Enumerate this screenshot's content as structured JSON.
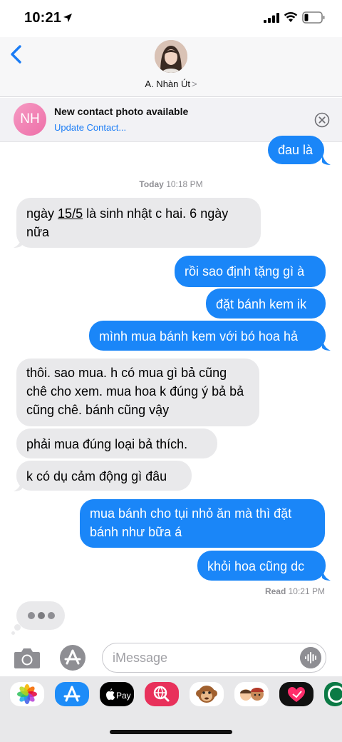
{
  "status_bar": {
    "time": "10:21"
  },
  "header": {
    "contact_name": "A. Nhàn Út",
    "chevron": ">"
  },
  "banner": {
    "initials": "NH",
    "title": "New contact photo available",
    "link": "Update Contact..."
  },
  "messages": [
    {
      "id": "m0",
      "dir": "sent",
      "text": "đau là"
    },
    {
      "id": "m1",
      "dir": "recv",
      "text_pre": "ngày ",
      "text_link": "15/5",
      "text_post": " là sinh nhật c hai. 6 ngày nữa"
    },
    {
      "id": "m2",
      "dir": "sent",
      "text": "rồi sao định tặng gì à"
    },
    {
      "id": "m3",
      "dir": "sent",
      "text": "đặt bánh kem ik"
    },
    {
      "id": "m4",
      "dir": "sent",
      "text": "mình mua bánh kem với bó hoa hả"
    },
    {
      "id": "m5",
      "dir": "recv",
      "text": "thôi. sao mua. h có mua gì bả cũng chê cho xem. mua hoa k đúng ý bả bả cũng chê. bánh cũng vậy"
    },
    {
      "id": "m6",
      "dir": "recv",
      "text": "phải mua đúng loại bả thích."
    },
    {
      "id": "m7",
      "dir": "recv",
      "text": "k có dụ cảm động gì đâu"
    },
    {
      "id": "m8",
      "dir": "sent",
      "text": "mua bánh cho tụi nhỏ ăn mà thì đặt bánh như bữa á"
    },
    {
      "id": "m9",
      "dir": "sent",
      "text": "khỏi hoa cũng dc"
    }
  ],
  "timestamp": {
    "day": "Today",
    "time": "10:18 PM"
  },
  "read_receipt": {
    "label": "Read",
    "time": "10:21 PM"
  },
  "input": {
    "placeholder": "iMessage"
  },
  "apps": [
    {
      "icon": "photos-icon"
    },
    {
      "icon": "app-store-icon"
    },
    {
      "icon": "apple-pay-icon",
      "label": "Pay"
    },
    {
      "icon": "web-search-icon"
    },
    {
      "icon": "monkey-animoji-icon"
    },
    {
      "icon": "memoji-icon"
    },
    {
      "icon": "digital-touch-icon"
    },
    {
      "icon": "starbucks-icon"
    }
  ],
  "colors": {
    "sent_bubble": "#1a86f8",
    "recv_bubble": "#e9e9eb",
    "link": "#1a7cf5"
  }
}
